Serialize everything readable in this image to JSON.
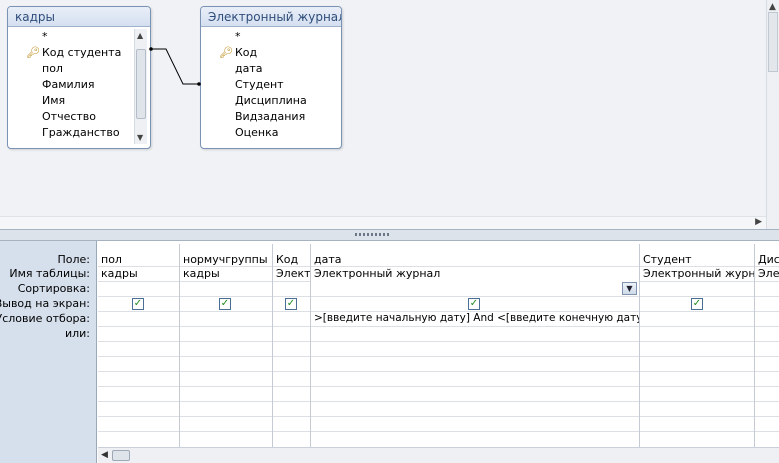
{
  "tables": [
    {
      "title": "кадры",
      "fields": [
        "*",
        "Код студента",
        "пол",
        "Фамилия",
        "Имя",
        "Отчество",
        "Гражданство"
      ],
      "key_field_index": 1
    },
    {
      "title": "Электронный журнал",
      "fields": [
        "*",
        "Код",
        "дата",
        "Студент",
        "Дисциплина",
        "Видзадания",
        "Оценка"
      ],
      "key_field_index": 1
    }
  ],
  "grid": {
    "row_labels": [
      "Поле:",
      "Имя таблицы:",
      "Сортировка:",
      "Вывод на экран:",
      "Условие отбора:",
      "или:"
    ],
    "columns": [
      {
        "field": "пол",
        "table": "кадры",
        "show": true,
        "criteria": ""
      },
      {
        "field": "нормучгруппы",
        "table": "кадры",
        "show": true,
        "criteria": ""
      },
      {
        "field": "Код",
        "table": "Электр",
        "show": true,
        "criteria": ""
      },
      {
        "field": "дата",
        "table": "Электронный журнал",
        "show": true,
        "criteria": ">[введите начальную дату] And <[введите конечную дату]"
      },
      {
        "field": "Студент",
        "table": "Электронный журна",
        "show": true,
        "criteria": ""
      },
      {
        "field": "Дис",
        "table": "Элек",
        "show": false,
        "criteria": ""
      }
    ]
  },
  "colors": {
    "table_title_text": "#2f4d7a",
    "label_pane_bg": "#d6e0ed",
    "checkbox_check": "#1f8a1f"
  }
}
